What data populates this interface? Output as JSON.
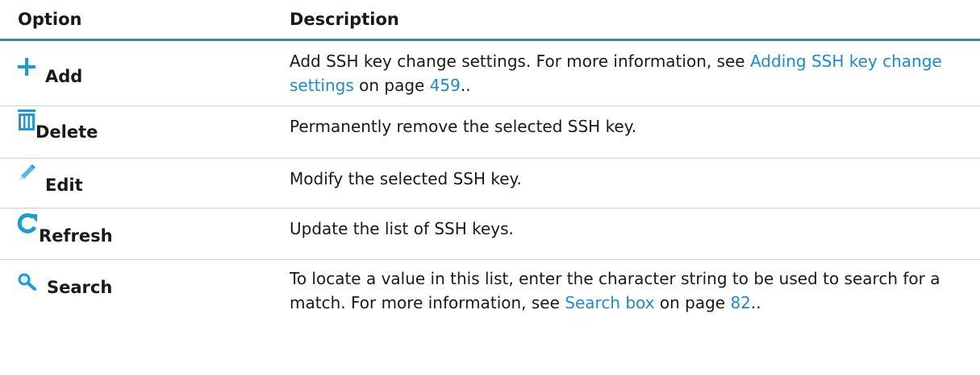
{
  "header": {
    "option": "Option",
    "description": "Description"
  },
  "rows": [
    {
      "icon": "plus-icon",
      "label": "Add",
      "desc_before": "Add SSH key change settings. For more information, see ",
      "link": "Adding SSH key change settings",
      "desc_mid": " on page ",
      "page": "459",
      "desc_after": ".."
    },
    {
      "icon": "trash-icon",
      "label": "Delete",
      "desc": "Permanently remove the selected SSH key."
    },
    {
      "icon": "pencil-icon",
      "label": "Edit",
      "desc": "Modify the selected SSH key."
    },
    {
      "icon": "refresh-icon",
      "label": "Refresh",
      "desc": "Update the list of SSH keys."
    },
    {
      "icon": "magnifier-icon",
      "label": "Search",
      "desc_before": "To locate a value in this list, enter the character string to be used to search for a match. For more information, see ",
      "link": "Search box",
      "desc_mid": " on page ",
      "page": "82",
      "desc_after": ".."
    }
  ],
  "colors": {
    "accent": "#3f8b8b",
    "link": "#1a8bd6",
    "icon": "#1d9bd9"
  }
}
